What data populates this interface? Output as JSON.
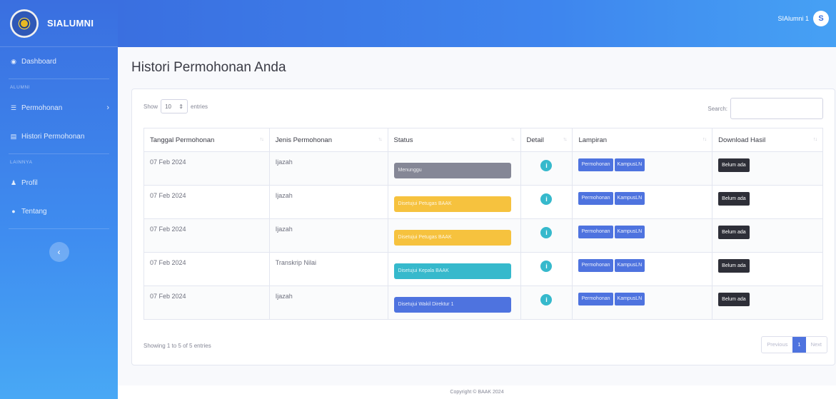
{
  "brand": {
    "name": "SIALUMNI",
    "logo_icon": "university-logo"
  },
  "sidebar": {
    "items": [
      {
        "label": "Dashboard",
        "icon": "dashboard-icon"
      },
      {
        "heading": "ALUMNI"
      },
      {
        "label": "Permohonan",
        "icon": "list-icon",
        "chevron": "›"
      },
      {
        "label": "Histori Permohonan",
        "icon": "history-icon"
      },
      {
        "heading": "LAINNYA"
      },
      {
        "label": "Profil",
        "icon": "user-icon"
      },
      {
        "label": "Tentang",
        "icon": "info-icon"
      }
    ],
    "toggle_glyph": "‹"
  },
  "topbar": {
    "user_name": "SIAlumni 1",
    "avatar_letter": "S"
  },
  "page": {
    "title": "Histori Permohonan Anda"
  },
  "table_controls": {
    "show_label": "Show",
    "entries_value": "10",
    "entries_label": "entries",
    "search_label": "Search:"
  },
  "table": {
    "headers": [
      "Tanggal Permohonan",
      "Jenis Permohonan",
      "Status",
      "Detail",
      "Lampiran",
      "Download Hasil"
    ],
    "rows": [
      {
        "tanggal": "07 Feb 2024",
        "jenis": "Ijazah",
        "status": "Menunggu",
        "status_color": "#858796",
        "lampiran": [
          "Permohonan",
          "KampusLN"
        ],
        "download": "Belum ada"
      },
      {
        "tanggal": "07 Feb 2024",
        "jenis": "Ijazah",
        "status": "Disetujui Petugas BAAK",
        "status_color": "#f6c23e",
        "lampiran": [
          "Permohonan",
          "KampusLN"
        ],
        "download": "Belum ada"
      },
      {
        "tanggal": "07 Feb 2024",
        "jenis": "Ijazah",
        "status": "Disetujui Petugas BAAK",
        "status_color": "#f6c23e",
        "lampiran": [
          "Permohonan",
          "KampusLN"
        ],
        "download": "Belum ada"
      },
      {
        "tanggal": "07 Feb 2024",
        "jenis": "Transkrip Nilai",
        "status": "Disetujui Kepala BAAK",
        "status_color": "#36b9cc",
        "lampiran": [
          "Permohonan",
          "KampusLN"
        ],
        "download": "Belum ada"
      },
      {
        "tanggal": "07 Feb 2024",
        "jenis": "Ijazah",
        "status": "Disetujui Wakil Direktur 1",
        "status_color": "#4e73df",
        "lampiran": [
          "Permohonan",
          "KampusLN"
        ],
        "download": "Belum ada"
      }
    ]
  },
  "pagination": {
    "info": "Showing 1 to 5 of 5 entries",
    "previous": "Previous",
    "current": "1",
    "next": "Next"
  },
  "footer": {
    "text": "Copyright © BAAK 2024"
  }
}
